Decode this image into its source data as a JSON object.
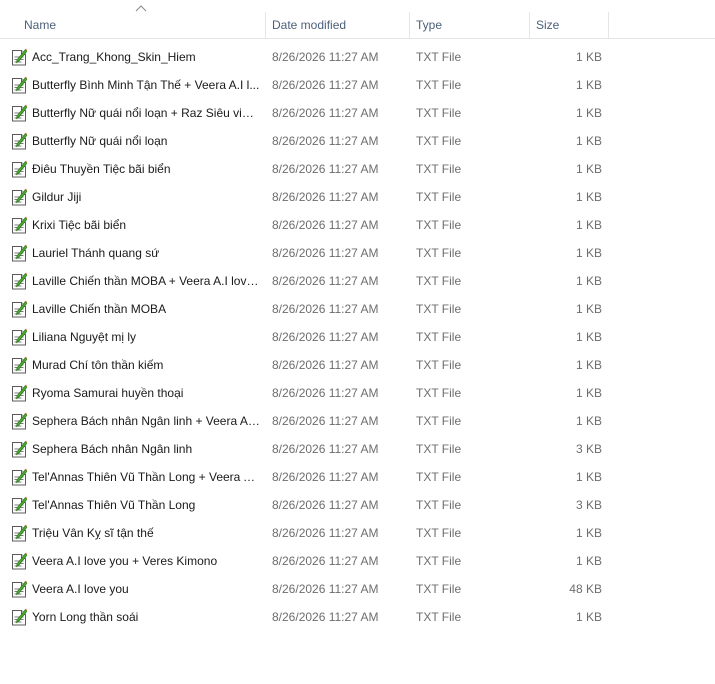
{
  "columns": {
    "name": "Name",
    "date_modified": "Date modified",
    "type": "Type",
    "size": "Size"
  },
  "sort": {
    "column": "name",
    "direction": "ascending"
  },
  "icon": "text-file-icon",
  "colors": {
    "header_text": "#4c607a",
    "name_text": "#1a1a1a",
    "detail_text": "#6d6d6d",
    "separator": "#e5e5e5"
  },
  "files": [
    {
      "name": "Acc_Trang_Khong_Skin_Hiem",
      "date": "8/26/2026 11:27 AM",
      "type": "TXT File",
      "size": "1 KB"
    },
    {
      "name": "Butterfly Bình Minh Tận Thế + Veera A.I l...",
      "date": "8/26/2026 11:27 AM",
      "type": "TXT File",
      "size": "1 KB"
    },
    {
      "name": "Butterfly Nữ quái nổi loạn + Raz Siêu việt...",
      "date": "8/26/2026 11:27 AM",
      "type": "TXT File",
      "size": "1 KB"
    },
    {
      "name": "Butterfly Nữ quái nổi loạn",
      "date": "8/26/2026 11:27 AM",
      "type": "TXT File",
      "size": "1 KB"
    },
    {
      "name": "Điêu Thuyền Tiệc bãi biển",
      "date": "8/26/2026 11:27 AM",
      "type": "TXT File",
      "size": "1 KB"
    },
    {
      "name": "Gildur Jiji",
      "date": "8/26/2026 11:27 AM",
      "type": "TXT File",
      "size": "1 KB"
    },
    {
      "name": "Krixi Tiệc bãi biển",
      "date": "8/26/2026 11:27 AM",
      "type": "TXT File",
      "size": "1 KB"
    },
    {
      "name": "Lauriel Thánh quang sứ",
      "date": "8/26/2026 11:27 AM",
      "type": "TXT File",
      "size": "1 KB"
    },
    {
      "name": "Laville Chiến thần MOBA + Veera A.I love...",
      "date": "8/26/2026 11:27 AM",
      "type": "TXT File",
      "size": "1 KB"
    },
    {
      "name": "Laville Chiến thần MOBA",
      "date": "8/26/2026 11:27 AM",
      "type": "TXT File",
      "size": "1 KB"
    },
    {
      "name": "Liliana Nguyệt mị ly",
      "date": "8/26/2026 11:27 AM",
      "type": "TXT File",
      "size": "1 KB"
    },
    {
      "name": "Murad Chí tôn thần kiếm",
      "date": "8/26/2026 11:27 AM",
      "type": "TXT File",
      "size": "1 KB"
    },
    {
      "name": "Ryoma Samurai huyền thoại",
      "date": "8/26/2026 11:27 AM",
      "type": "TXT File",
      "size": "1 KB"
    },
    {
      "name": "Sephera Bách nhân Ngân linh + Veera A.I...",
      "date": "8/26/2026 11:27 AM",
      "type": "TXT File",
      "size": "1 KB"
    },
    {
      "name": "Sephera Bách nhân Ngân linh",
      "date": "8/26/2026 11:27 AM",
      "type": "TXT File",
      "size": "3 KB"
    },
    {
      "name": "Tel'Annas Thiên Vũ Thần Long + Veera A....",
      "date": "8/26/2026 11:27 AM",
      "type": "TXT File",
      "size": "1 KB"
    },
    {
      "name": "Tel'Annas Thiên Vũ Thần Long",
      "date": "8/26/2026 11:27 AM",
      "type": "TXT File",
      "size": "3 KB"
    },
    {
      "name": "Triệu Vân Kỵ sĩ tận thế",
      "date": "8/26/2026 11:27 AM",
      "type": "TXT File",
      "size": "1 KB"
    },
    {
      "name": "Veera A.I love you + Veres Kimono",
      "date": "8/26/2026 11:27 AM",
      "type": "TXT File",
      "size": "1 KB"
    },
    {
      "name": "Veera A.I love you",
      "date": "8/26/2026 11:27 AM",
      "type": "TXT File",
      "size": "48 KB"
    },
    {
      "name": "Yorn Long thần soái",
      "date": "8/26/2026 11:27 AM",
      "type": "TXT File",
      "size": "1 KB"
    }
  ]
}
